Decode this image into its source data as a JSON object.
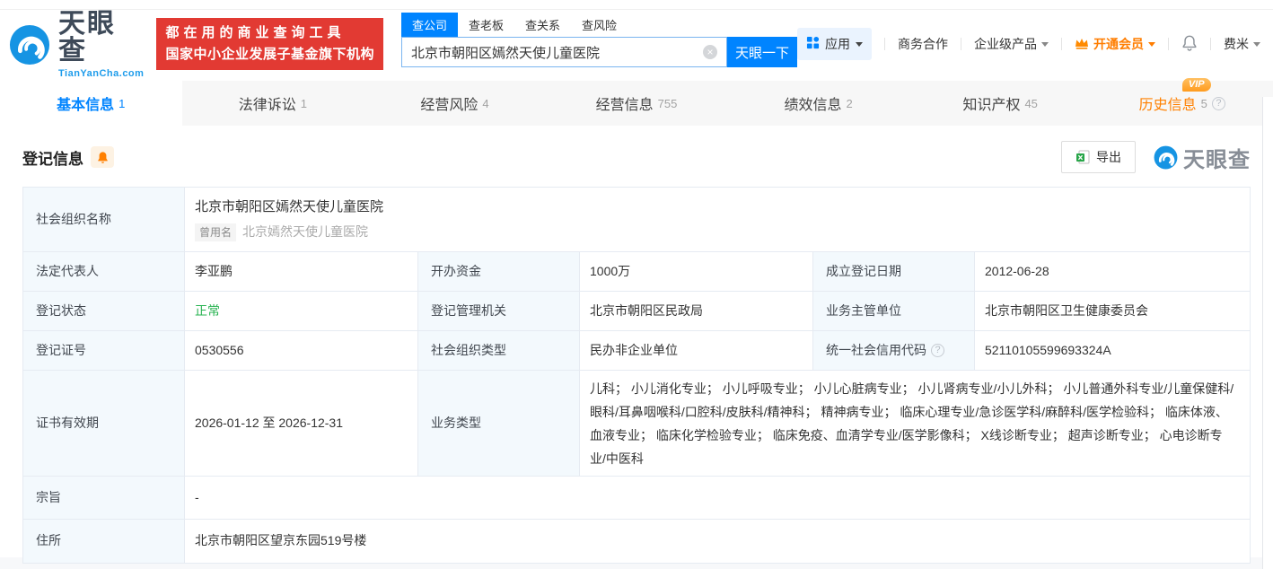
{
  "colors": {
    "accent": "#0084ff",
    "brand_red": "#e23a33",
    "vip_orange": "#ff8000",
    "status_green": "#28b351"
  },
  "icons": {
    "question": "?",
    "clear": "×"
  },
  "header": {
    "logo": {
      "brand": "天眼查",
      "domain": "TianYanCha.com"
    },
    "slogan": {
      "line1": "都在用的商业查询工具",
      "line2": "国家中小企业发展子基金旗下机构"
    },
    "search": {
      "tabs": [
        {
          "label": "查公司"
        },
        {
          "label": "查老板"
        },
        {
          "label": "查关系"
        },
        {
          "label": "查风险"
        }
      ],
      "value": "北京市朝阳区嫣然天使儿童医院",
      "button": "天眼一下"
    },
    "menu": {
      "apps": "应用",
      "cooperation": "商务合作",
      "enterprise": "企业级产品",
      "vip": "开通会员",
      "user": "费米"
    }
  },
  "nav_tabs": [
    {
      "label": "基本信息",
      "count": "1"
    },
    {
      "label": "法律诉讼",
      "count": "1"
    },
    {
      "label": "经营风险",
      "count": "4"
    },
    {
      "label": "经营信息",
      "count": "755"
    },
    {
      "label": "绩效信息",
      "count": "2"
    },
    {
      "label": "知识产权",
      "count": "45"
    },
    {
      "label": "历史信息",
      "count": "5",
      "vip": "VIP"
    }
  ],
  "section": {
    "title": "登记信息",
    "export_label": "导出",
    "watermark": "天眼查"
  },
  "registration": {
    "org_name_label": "社会组织名称",
    "org_name": "北京市朝阳区嫣然天使儿童医院",
    "former_name_tag": "曾用名",
    "former_name": "北京嫣然天使儿童医院",
    "legal_rep_label": "法定代表人",
    "legal_rep": "李亚鹏",
    "capital_label": "开办资金",
    "capital": "1000万",
    "reg_date_label": "成立登记日期",
    "reg_date": "2012-06-28",
    "status_label": "登记状态",
    "status": "正常",
    "authority_label": "登记管理机关",
    "authority": "北京市朝阳区民政局",
    "supervisor_label": "业务主管单位",
    "supervisor": "北京市朝阳区卫生健康委员会",
    "cert_no_label": "登记证号",
    "cert_no": "0530556",
    "org_type_label": "社会组织类型",
    "org_type": "民办非企业单位",
    "credit_code_label": "统一社会信用代码",
    "credit_code": "52110105599693324A",
    "validity_label": "证书有效期",
    "validity": "2026-01-12 至 2026-12-31",
    "business_label": "业务类型",
    "business": "儿科； 小儿消化专业； 小儿呼吸专业； 小儿心脏病专业； 小儿肾病专业/小儿外科； 小儿普通外科专业/儿童保健科/眼科/耳鼻咽喉科/口腔科/皮肤科/精神科； 精神病专业； 临床心理专业/急诊医学科/麻醉科/医学检验科； 临床体液、血液专业； 临床化学检验专业； 临床免疫、血清学专业/医学影像科； X线诊断专业； 超声诊断专业； 心电诊断专业/中医科",
    "purpose_label": "宗旨",
    "purpose": "-",
    "address_label": "住所",
    "address": "北京市朝阳区望京东园519号楼"
  }
}
